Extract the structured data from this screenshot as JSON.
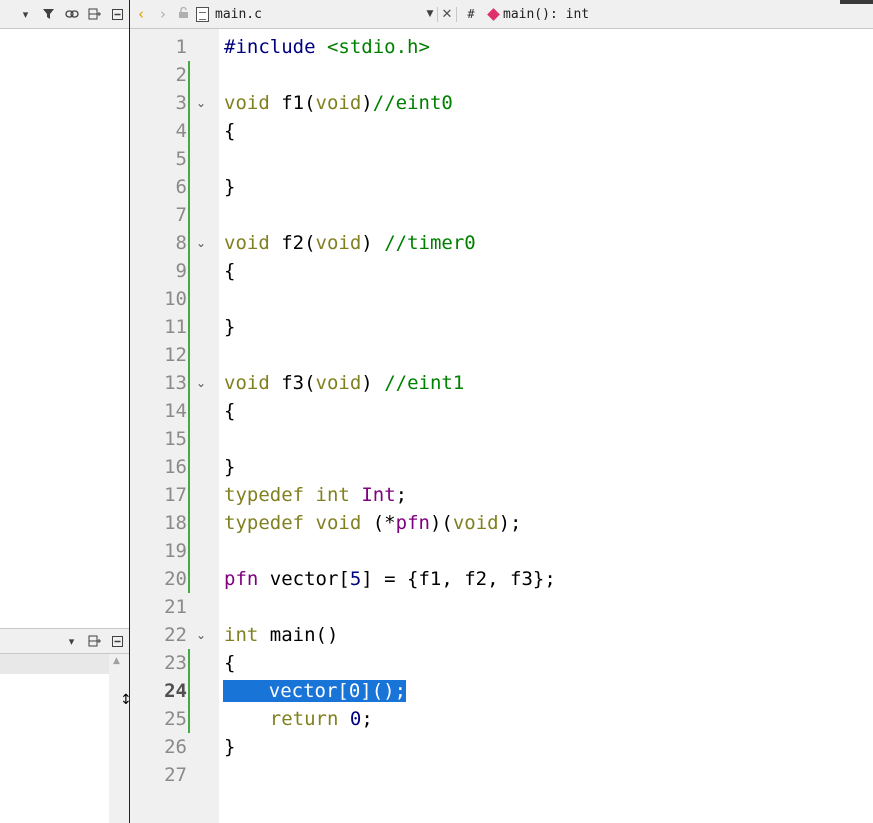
{
  "left_toolbar": {
    "icons": [
      "dropdown-icon",
      "filter-icon",
      "link-icon",
      "split-icon",
      "minimize-icon"
    ]
  },
  "editor_toolbar": {
    "file_name": "main.c",
    "symbol_prefix": "#",
    "symbol": "main(): int"
  },
  "lower_panel_toolbar": {
    "icons": [
      "dropdown-icon",
      "split-icon",
      "minimize-icon"
    ]
  },
  "editor": {
    "current_line": 24,
    "lines": [
      {
        "n": "1",
        "text": "#include <stdio.h>"
      },
      {
        "n": "2",
        "text": ""
      },
      {
        "n": "3",
        "text": "void f1(void)//eint0"
      },
      {
        "n": "4",
        "text": "{"
      },
      {
        "n": "5",
        "text": ""
      },
      {
        "n": "6",
        "text": "}"
      },
      {
        "n": "7",
        "text": ""
      },
      {
        "n": "8",
        "text": "void f2(void) //timer0"
      },
      {
        "n": "9",
        "text": "{"
      },
      {
        "n": "10",
        "text": ""
      },
      {
        "n": "11",
        "text": "}"
      },
      {
        "n": "12",
        "text": ""
      },
      {
        "n": "13",
        "text": "void f3(void) //eint1"
      },
      {
        "n": "14",
        "text": "{"
      },
      {
        "n": "15",
        "text": ""
      },
      {
        "n": "16",
        "text": "}"
      },
      {
        "n": "17",
        "text": "typedef int Int;"
      },
      {
        "n": "18",
        "text": "typedef void (*pfn)(void);"
      },
      {
        "n": "19",
        "text": ""
      },
      {
        "n": "20",
        "text": "pfn vector[5] = {f1, f2, f3};"
      },
      {
        "n": "21",
        "text": ""
      },
      {
        "n": "22",
        "text": "int main()"
      },
      {
        "n": "23",
        "text": "{"
      },
      {
        "n": "24",
        "text": "    vector[0]();"
      },
      {
        "n": "25",
        "text": "    return 0;"
      },
      {
        "n": "26",
        "text": "}"
      },
      {
        "n": "27",
        "text": ""
      }
    ]
  },
  "colors": {
    "keyword": "#808020",
    "preprocessor": "#000080",
    "comment": "#008000",
    "typedef_name": "#800080",
    "selection": "#1874d6",
    "change_bar": "#44aa44"
  }
}
